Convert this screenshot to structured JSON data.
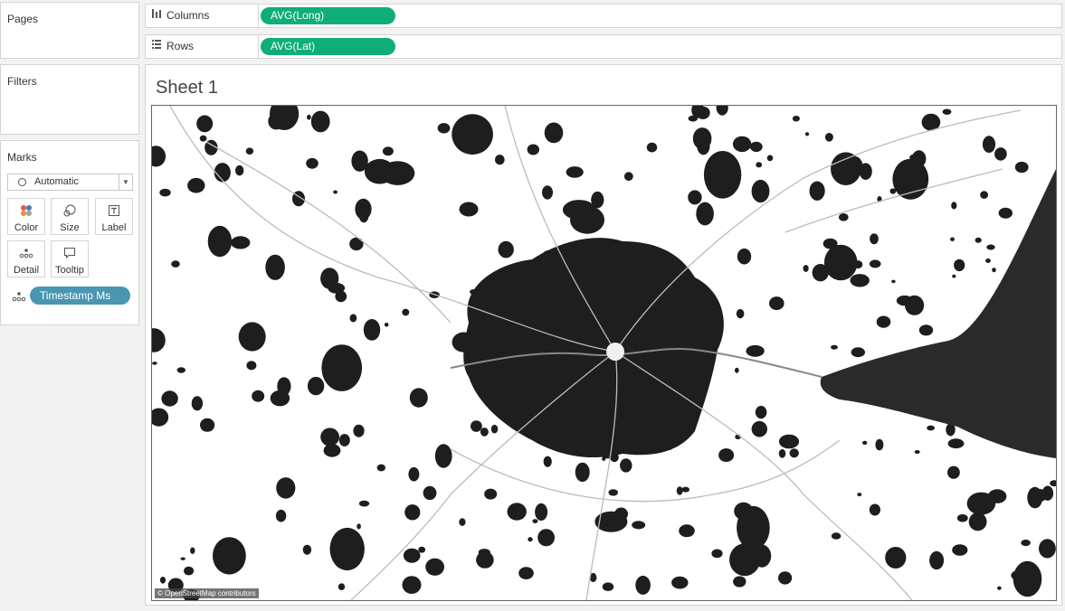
{
  "cards": {
    "pages_title": "Pages",
    "filters_title": "Filters",
    "marks_title": "Marks"
  },
  "shelves": {
    "columns_label": "Columns",
    "columns_pill": "AVG(Long)",
    "rows_label": "Rows",
    "rows_pill": "AVG(Lat)"
  },
  "marks": {
    "type": "Automatic",
    "buttons": {
      "color": "Color",
      "size": "Size",
      "label": "Label",
      "detail": "Detail",
      "tooltip": "Tooltip"
    },
    "detail_field": "Timestamp Ms"
  },
  "sheet": {
    "title": "Sheet 1",
    "map_attribution": "© OpenStreetMap contributors"
  },
  "colors": {
    "continuous_pill": "#0fae79",
    "detail_pill": "#4996b2",
    "land_dark": "#1e1e1e",
    "map_background": "#ffffff",
    "water": "#2a2a2a"
  }
}
